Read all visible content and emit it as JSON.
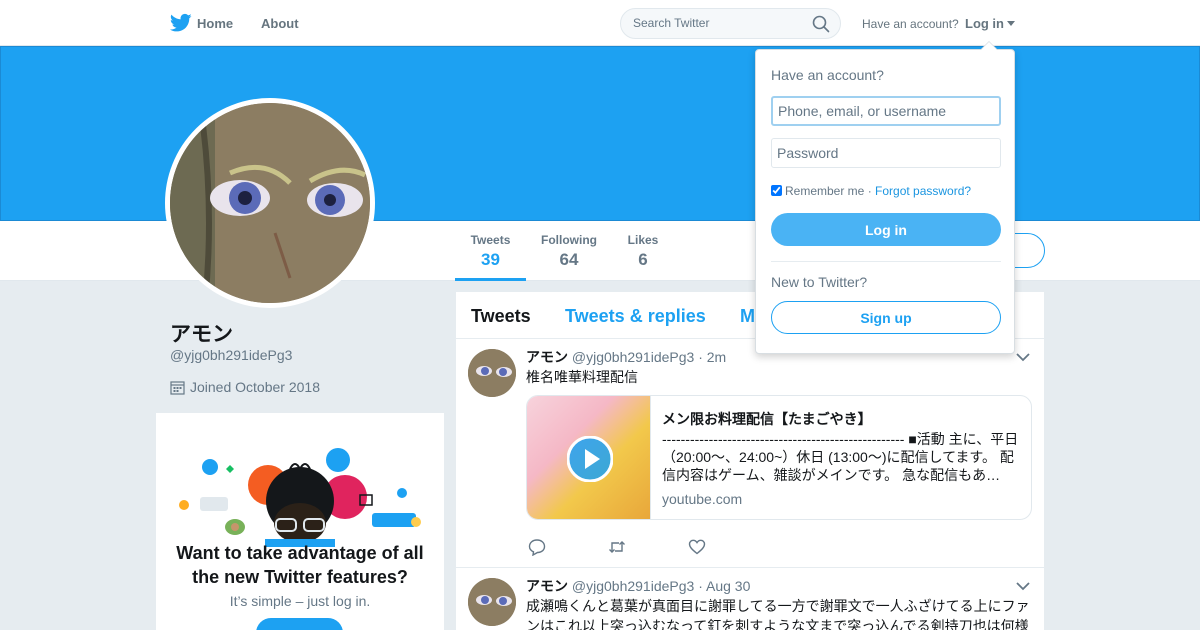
{
  "nav": {
    "home": "Home",
    "about": "About",
    "search_placeholder": "Search Twitter",
    "have_account": "Have an account?",
    "login": "Log in"
  },
  "profile": {
    "name": "アモン",
    "handle": "@yjg0bh291idePg3",
    "joined": "Joined October 2018",
    "stats": [
      {
        "label": "Tweets",
        "value": "39"
      },
      {
        "label": "Following",
        "value": "64"
      },
      {
        "label": "Likes",
        "value": "6"
      }
    ]
  },
  "promo": {
    "title": "Want to take advantage of all the new Twitter features?",
    "subtitle": "It’s simple – just log in."
  },
  "timeline": {
    "tabs": [
      "Tweets",
      "Tweets & replies",
      "M"
    ],
    "tweets": [
      {
        "name": "アモン",
        "meta": "@yjg0bh291idePg3 · 2m",
        "text": "椎名唯華料理配信",
        "card": {
          "title": "メン限お料理配信【たまごやき】",
          "description": "---------------------------------------------------- ■活動 主に、平日（20:00～、24:00~）休日 (13:00～)に配信してます。 配信内容はゲーム、雑談がメインです。 急な配信もあ…",
          "domain": "youtube.com"
        }
      },
      {
        "name": "アモン",
        "meta": "@yjg0bh291idePg3 · Aug 30",
        "text": "成瀬鳴くんと葛葉が真面目に謝罪してる一方で謝罪文で一人ふざけてる上にファンはこれ以上突っ込むなって釘を刺すような文まで突っ込んでる剣持刀也は何様"
      }
    ]
  },
  "login_dropdown": {
    "heading": "Have an account?",
    "username_placeholder": "Phone, email, or username",
    "password_placeholder": "Password",
    "remember": "Remember me",
    "separator": " · ",
    "forgot": "Forgot password?",
    "login_button": "Log in",
    "new_to": "New to Twitter?",
    "signup_button": "Sign up"
  },
  "colors": {
    "brand_blue": "#1da1f2",
    "link_blue": "#1b95e0",
    "muted_gray": "#657786",
    "page_bg": "#e6ecf0"
  }
}
